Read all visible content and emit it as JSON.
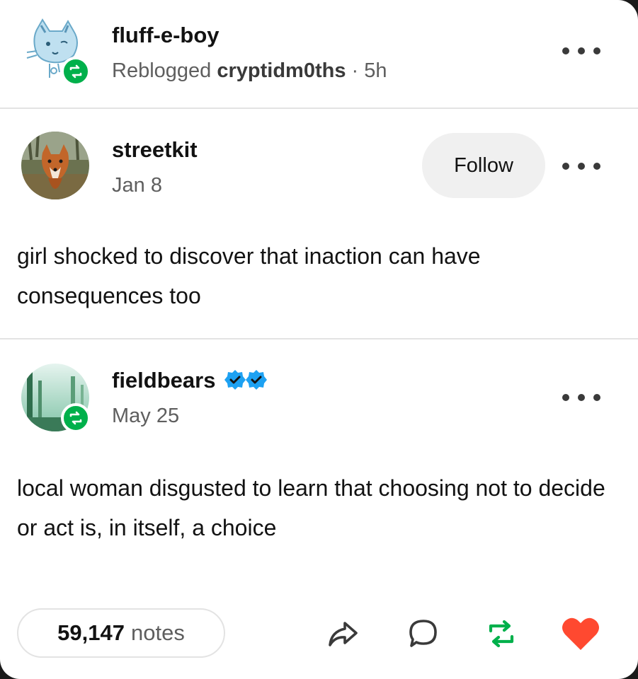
{
  "reblogger": {
    "username": "fluff-e-boy",
    "reblogged_prefix": "Reblogged",
    "reblogged_from": "cryptidm0ths",
    "separator": "·",
    "time": "5h"
  },
  "post1": {
    "username": "streetkit",
    "date": "Jan 8",
    "follow_label": "Follow",
    "body": "girl shocked to discover that inaction can have consequences too"
  },
  "post2": {
    "username": "fieldbears",
    "date": "May 25",
    "body": "local woman disgusted to learn that choosing not to decide or act is, in itself, a choice"
  },
  "footer": {
    "notes_count": "59,147",
    "notes_label": "notes"
  },
  "icons": {
    "more": "more-dots-icon",
    "share": "share-icon",
    "reply": "reply-icon",
    "reblog": "reblog-icon",
    "like": "heart-icon",
    "verified": "verified-badge-icon"
  },
  "colors": {
    "reblog_green": "#00b04b",
    "like_red": "#ff4930",
    "verified_blue": "#1da1f2"
  }
}
